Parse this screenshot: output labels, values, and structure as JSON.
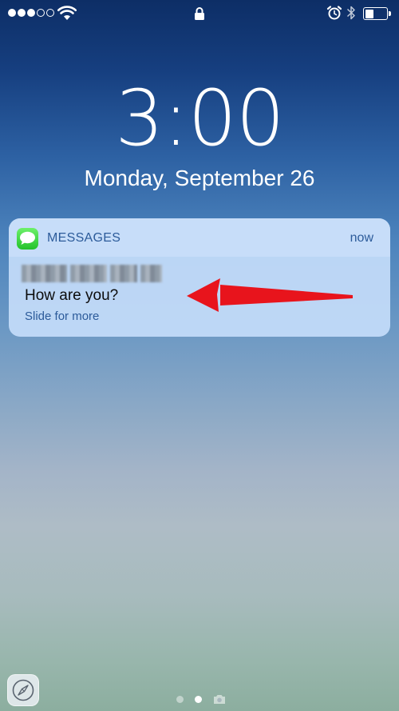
{
  "status_bar": {
    "signal_dots_filled": 3,
    "signal_dots_total": 5,
    "battery_level": 0.4,
    "icons": [
      "wifi-icon",
      "lock-icon",
      "alarm-icon",
      "bluetooth-icon",
      "battery-icon"
    ]
  },
  "lock_screen": {
    "time": "3:00",
    "date": "Monday, September 26"
  },
  "notification": {
    "app_name": "MESSAGES",
    "time": "now",
    "message": "How are you?",
    "action_hint": "Slide for more",
    "app_icon": "messages-icon"
  },
  "page_indicator": {
    "pages": 2,
    "active_page": 2,
    "camera_icon": "camera-icon"
  },
  "bottom_left_icon": "safari-icon",
  "colors": {
    "notification_accent": "#2c5b9a",
    "annotation_arrow": "#e8141c",
    "messages_green": "#34c83a"
  }
}
